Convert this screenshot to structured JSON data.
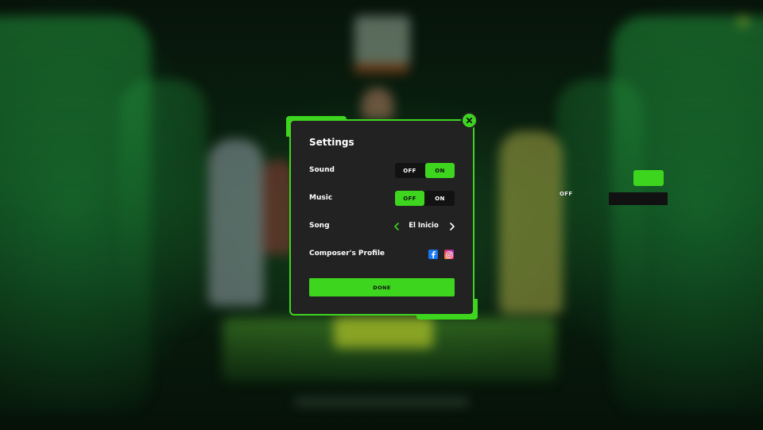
{
  "settings": {
    "title": "Settings",
    "sound": {
      "label": "Sound",
      "off_label": "OFF",
      "on_label": "ON",
      "value": "on"
    },
    "music": {
      "label": "Music",
      "off_label": "OFF",
      "on_label": "ON",
      "value": "off"
    },
    "song": {
      "label": "Song",
      "current": "El Inicio"
    },
    "composer": {
      "label": "Composer's Profile"
    },
    "done_label": "DONE"
  },
  "background": {
    "ghost_toggle_off_label": "OFF"
  },
  "icons": {
    "close": "close-icon",
    "prev": "chevron-left-icon",
    "next": "chevron-right-icon",
    "facebook": "facebook-icon",
    "instagram": "instagram-icon"
  },
  "colors": {
    "accent": "#3ed51f",
    "panel": "#222222",
    "toggle_track": "#121212",
    "facebook": "#1877f2"
  }
}
